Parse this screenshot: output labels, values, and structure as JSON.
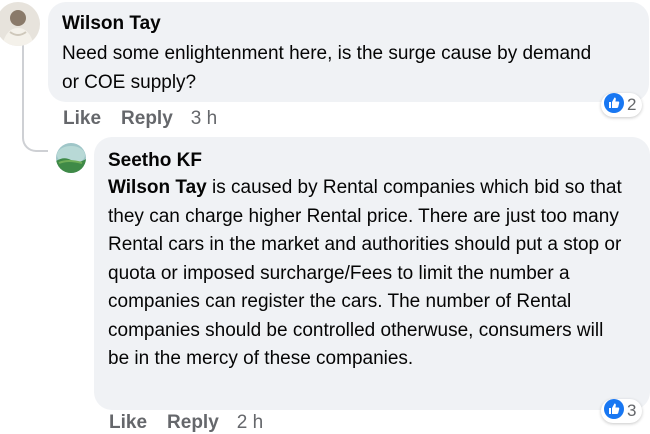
{
  "comments": [
    {
      "author": "Wilson Tay",
      "text": "Need some enlightenment here, is the surge cause by demand or COE supply?",
      "actions": {
        "like": "Like",
        "reply": "Reply",
        "time": "3 h"
      },
      "reactions": {
        "icon": "like-icon",
        "count": "2"
      }
    }
  ],
  "reply": {
    "author": "Seetho KF",
    "mention": "Wilson Tay",
    "text": " is caused by Rental companies which bid so that they can charge higher Rental price. There are just too many Rental cars in the market and authorities should put a stop or quota or imposed surcharge/Fees to limit the number a companies can register the cars. The number of Rental companies should be controlled otherwuse, consumers will be in the mercy of these companies.",
    "actions": {
      "like": "Like",
      "reply": "Reply",
      "time": "2 h"
    },
    "reactions": {
      "icon": "like-icon",
      "count": "3"
    }
  },
  "colors": {
    "bubble": "#f0f2f5",
    "secondary_text": "#65676b",
    "like_blue": "#1877f2"
  }
}
